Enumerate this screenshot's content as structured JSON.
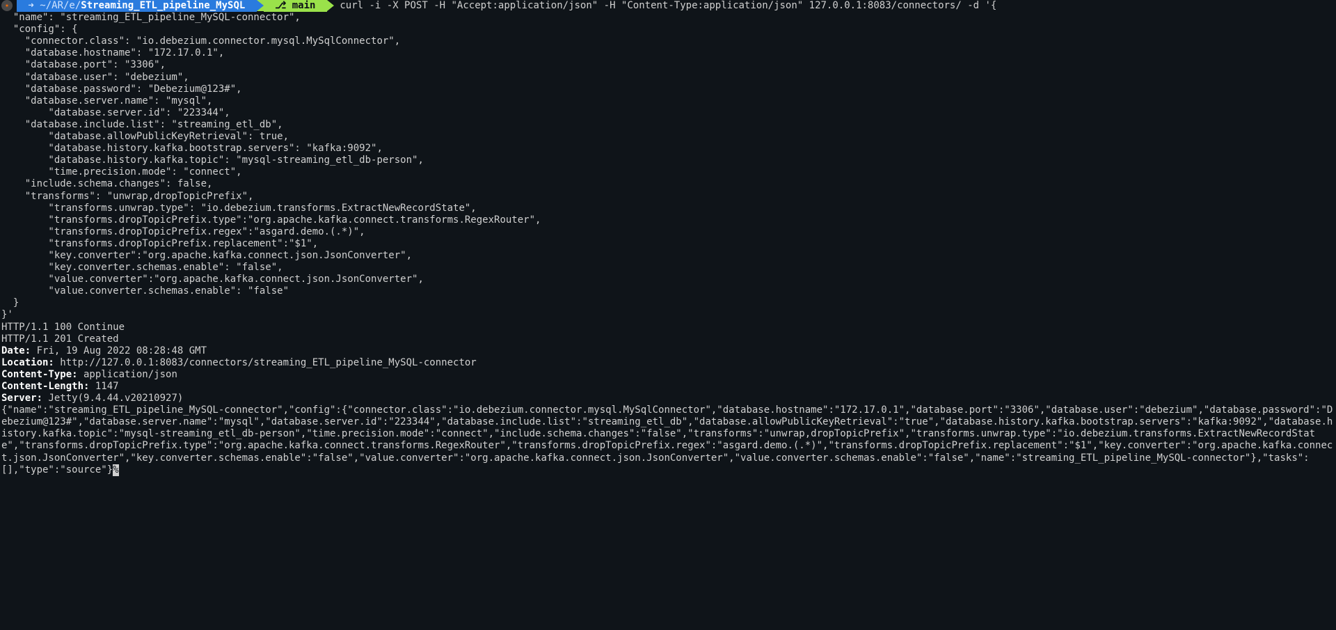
{
  "prompt": {
    "path_prefix": " ➜ ~/AR/e/",
    "path_highlight": "Streaming_ETL_pipeline_MySQL",
    "git_icon": " ",
    "git_branch_icon": "⎇",
    "git_branch": " main ",
    "command": "curl -i -X POST -H \"Accept:application/json\" -H \"Content-Type:application/json\" 127.0.0.1:8083/connectors/ -d '{"
  },
  "request_body": [
    "  \"name\": \"streaming_ETL_pipeline_MySQL-connector\",",
    "  \"config\": {",
    "    \"connector.class\": \"io.debezium.connector.mysql.MySqlConnector\",",
    "    \"database.hostname\": \"172.17.0.1\",",
    "    \"database.port\": \"3306\",",
    "    \"database.user\": \"debezium\",",
    "    \"database.password\": \"Debezium@123#\",",
    "    \"database.server.name\": \"mysql\",",
    "        \"database.server.id\": \"223344\",",
    "    \"database.include.list\": \"streaming_etl_db\",",
    "        \"database.allowPublicKeyRetrieval\": true,",
    "        \"database.history.kafka.bootstrap.servers\": \"kafka:9092\",",
    "        \"database.history.kafka.topic\": \"mysql-streaming_etl_db-person\",",
    "        \"time.precision.mode\": \"connect\",",
    "    \"include.schema.changes\": false,",
    "    \"transforms\": \"unwrap,dropTopicPrefix\",",
    "        \"transforms.unwrap.type\": \"io.debezium.transforms.ExtractNewRecordState\",",
    "        \"transforms.dropTopicPrefix.type\":\"org.apache.kafka.connect.transforms.RegexRouter\",",
    "        \"transforms.dropTopicPrefix.regex\":\"asgard.demo.(.*)\",",
    "        \"transforms.dropTopicPrefix.replacement\":\"$1\",",
    "        \"key.converter\":\"org.apache.kafka.connect.json.JsonConverter\",",
    "        \"key.converter.schemas.enable\": \"false\",",
    "        \"value.converter\":\"org.apache.kafka.connect.json.JsonConverter\",",
    "        \"value.converter.schemas.enable\": \"false\"",
    "  }",
    "}'"
  ],
  "resp_continue": "HTTP/1.1 100 Continue",
  "blank": "",
  "resp_created": "HTTP/1.1 201 Created",
  "headers": {
    "date_k": "Date:",
    "date_v": " Fri, 19 Aug 2022 08:28:48 GMT",
    "loc_k": "Location:",
    "loc_v": " http://127.0.0.1:8083/connectors/streaming_ETL_pipeline_MySQL-connector",
    "ct_k": "Content-Type:",
    "ct_v": " application/json",
    "cl_k": "Content-Length:",
    "cl_v": " 1147",
    "srv_k": "Server:",
    "srv_v": " Jetty(9.4.44.v20210927)"
  },
  "response_body": "{\"name\":\"streaming_ETL_pipeline_MySQL-connector\",\"config\":{\"connector.class\":\"io.debezium.connector.mysql.MySqlConnector\",\"database.hostname\":\"172.17.0.1\",\"database.port\":\"3306\",\"database.user\":\"debezium\",\"database.password\":\"Debezium@123#\",\"database.server.name\":\"mysql\",\"database.server.id\":\"223344\",\"database.include.list\":\"streaming_etl_db\",\"database.allowPublicKeyRetrieval\":\"true\",\"database.history.kafka.bootstrap.servers\":\"kafka:9092\",\"database.history.kafka.topic\":\"mysql-streaming_etl_db-person\",\"time.precision.mode\":\"connect\",\"include.schema.changes\":\"false\",\"transforms\":\"unwrap,dropTopicPrefix\",\"transforms.unwrap.type\":\"io.debezium.transforms.ExtractNewRecordState\",\"transforms.dropTopicPrefix.type\":\"org.apache.kafka.connect.transforms.RegexRouter\",\"transforms.dropTopicPrefix.regex\":\"asgard.demo.(.*)\",\"transforms.dropTopicPrefix.replacement\":\"$1\",\"key.converter\":\"org.apache.kafka.connect.json.JsonConverter\",\"key.converter.schemas.enable\":\"false\",\"value.converter\":\"org.apache.kafka.connect.json.JsonConverter\",\"value.converter.schemas.enable\":\"false\",\"name\":\"streaming_ETL_pipeline_MySQL-connector\"},\"tasks\":[],\"type\":\"source\"}",
  "cursor_char": "%"
}
